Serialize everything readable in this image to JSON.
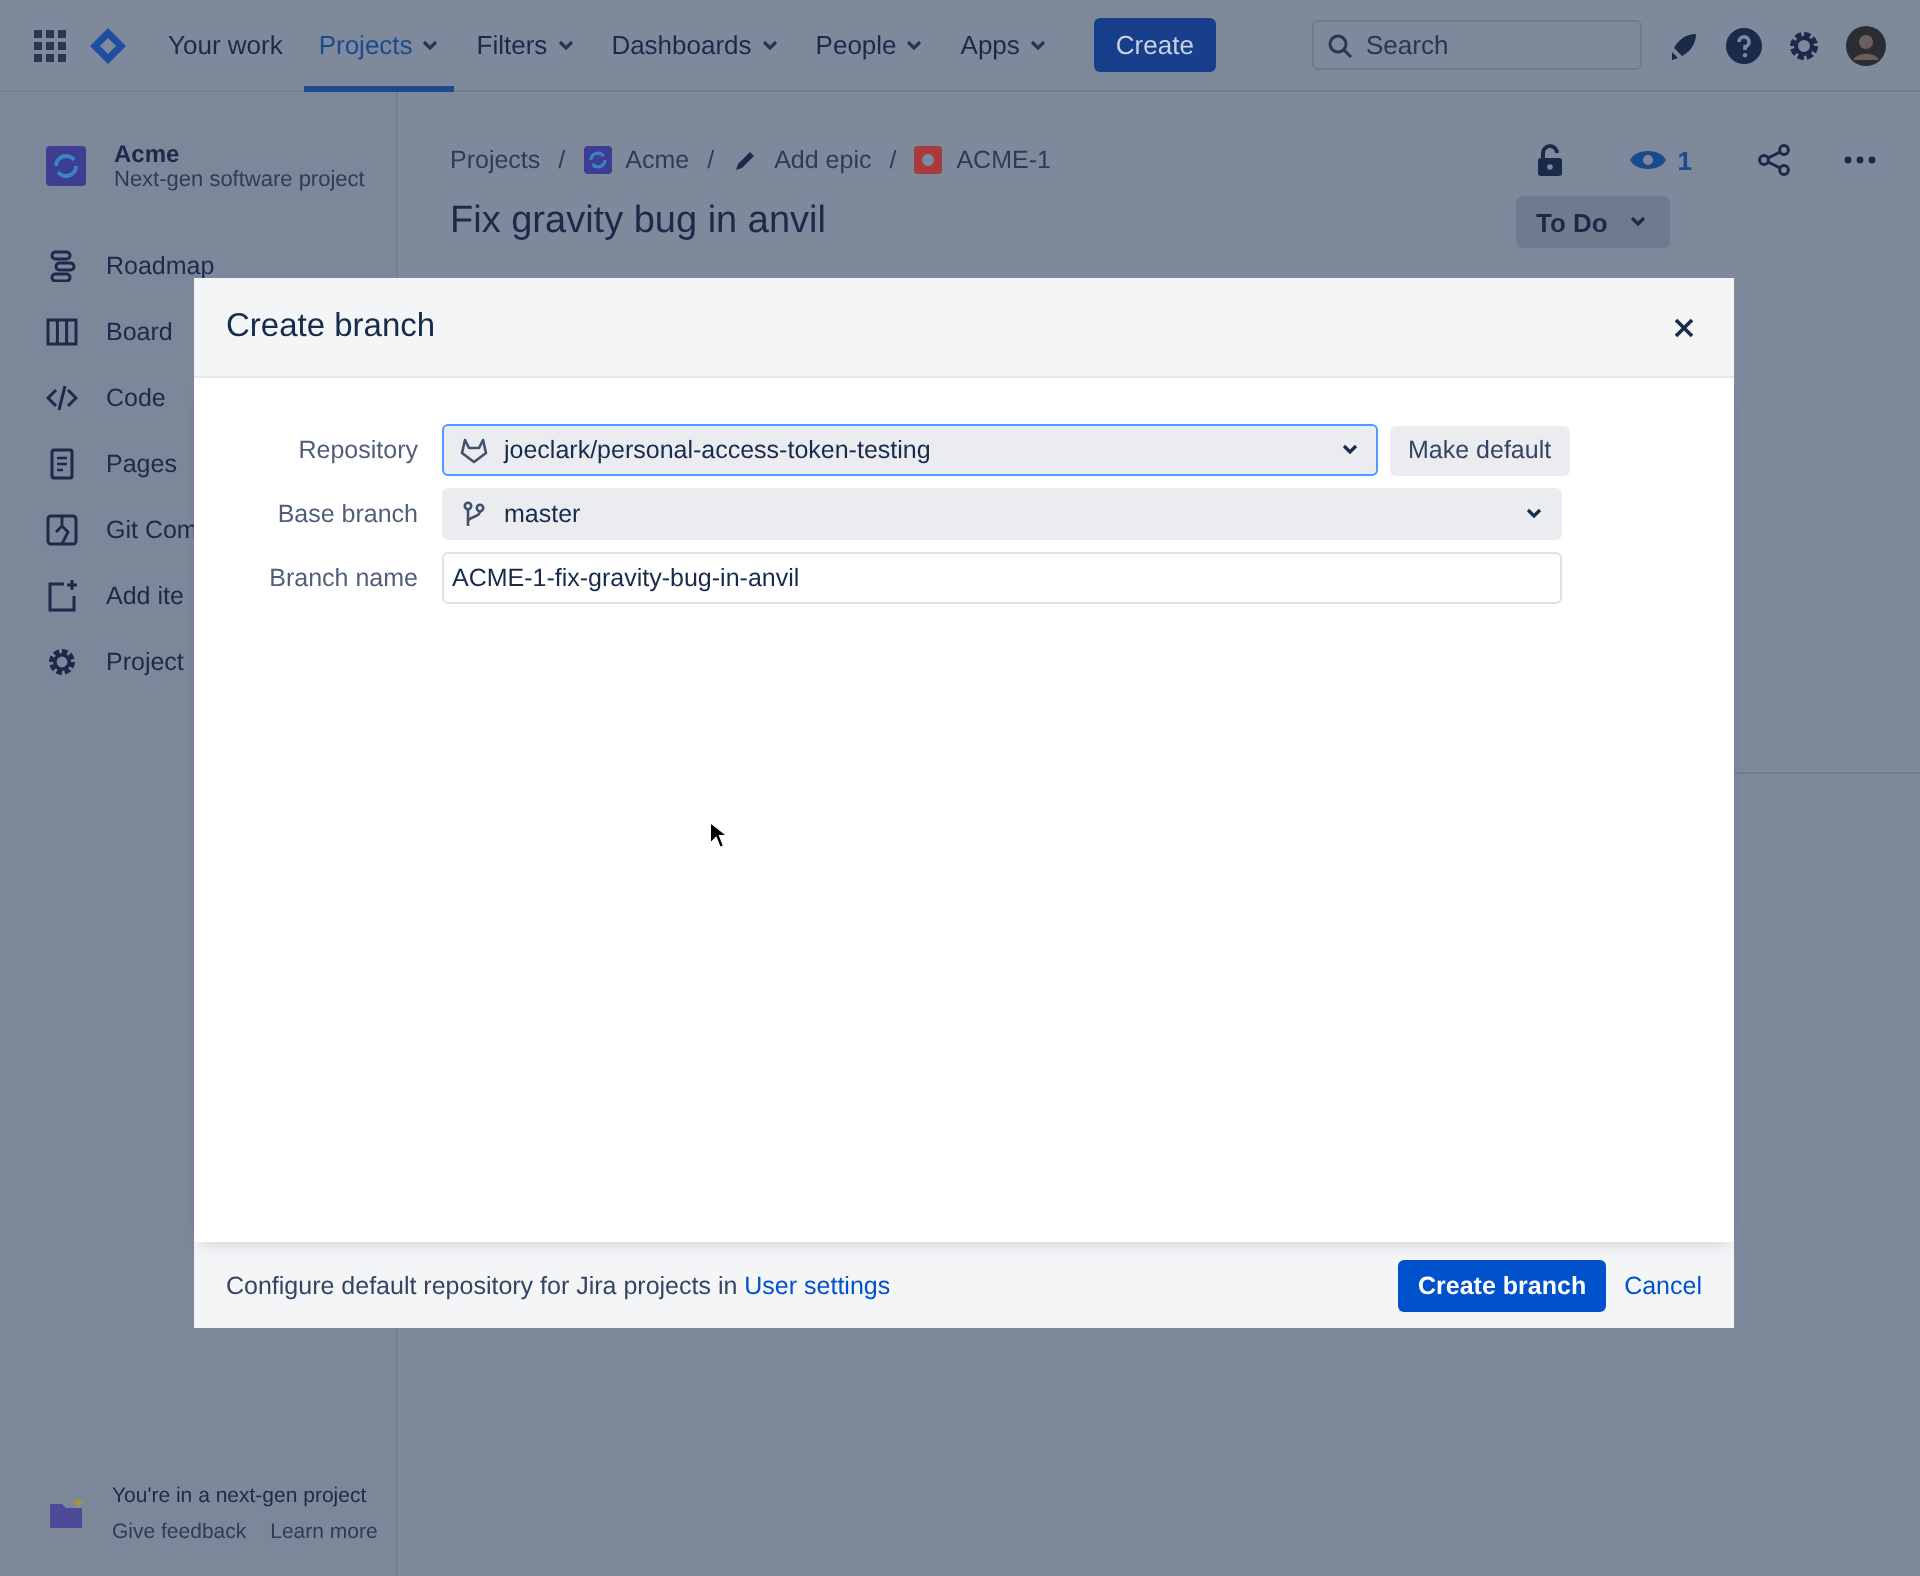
{
  "top_nav": {
    "items": [
      {
        "label": "Your work",
        "selected": false,
        "menu": false
      },
      {
        "label": "Projects",
        "selected": true,
        "menu": true
      },
      {
        "label": "Filters",
        "selected": false,
        "menu": true
      },
      {
        "label": "Dashboards",
        "selected": false,
        "menu": true
      },
      {
        "label": "People",
        "selected": false,
        "menu": true
      },
      {
        "label": "Apps",
        "selected": false,
        "menu": true
      }
    ],
    "create": "Create",
    "search": {
      "placeholder": "Search"
    }
  },
  "sidebar": {
    "project": {
      "name": "Acme",
      "subtitle": "Next-gen software project"
    },
    "items": [
      {
        "label": "Roadmap",
        "kind": "roadmap"
      },
      {
        "label": "Board",
        "kind": "board"
      },
      {
        "label": "Code",
        "kind": "code"
      },
      {
        "label": "Pages",
        "kind": "pages"
      },
      {
        "label": "Git Com",
        "kind": "git"
      },
      {
        "label": "Add ite",
        "kind": "add"
      },
      {
        "label": "Project",
        "kind": "settings"
      }
    ],
    "footer": {
      "text": "You're in a next-gen project",
      "links": [
        "Give feedback",
        "Learn more"
      ]
    }
  },
  "issue": {
    "breadcrumbs": [
      {
        "label": "Projects",
        "kind": "plain"
      },
      {
        "separator": "/",
        "label": "Acme",
        "kind": "project"
      },
      {
        "separator": "/",
        "label": "Add epic",
        "kind": "epic"
      },
      {
        "separator": "/",
        "label": "ACME-1",
        "kind": "bug"
      }
    ],
    "watchers": "1",
    "title": "Fix gravity bug in anvil",
    "status": "To Do"
  },
  "dialog": {
    "title": "Create branch",
    "fields": [
      {
        "label": "Repository",
        "kind": "select",
        "value": "joeclark/personal-access-token-testing",
        "focused": true,
        "action": "Make default"
      },
      {
        "label": "Base branch",
        "kind": "select",
        "value": "master",
        "focused": false
      },
      {
        "label": "Branch name",
        "kind": "text",
        "value": "ACME-1-fix-gravity-bug-in-anvil",
        "focused": false
      }
    ],
    "footer_text": "Configure default repository for Jira projects in",
    "footer_link": "User settings",
    "primary": "Create branch",
    "cancel": "Cancel"
  }
}
